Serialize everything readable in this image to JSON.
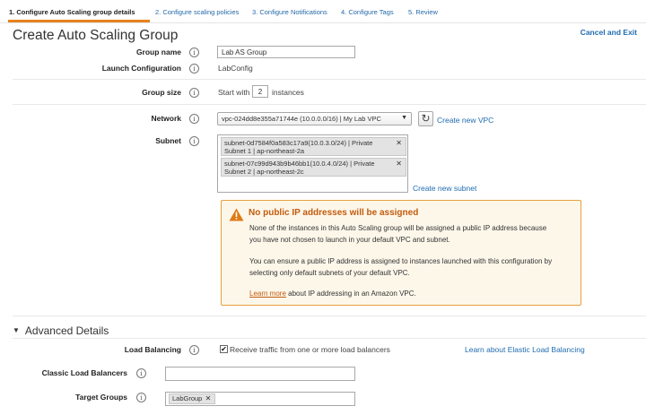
{
  "wizard_tabs": [
    {
      "label": "1. Configure Auto Scaling group details",
      "active": true
    },
    {
      "label": "2. Configure scaling policies",
      "active": false
    },
    {
      "label": "3. Configure Notifications",
      "active": false
    },
    {
      "label": "4. Configure Tags",
      "active": false
    },
    {
      "label": "5. Review",
      "active": false
    }
  ],
  "header": {
    "title": "Create Auto Scaling Group",
    "cancel_label": "Cancel and Exit"
  },
  "form": {
    "group_name": {
      "label": "Group name",
      "value": "Lab AS Group"
    },
    "launch_configuration": {
      "label": "Launch Configuration",
      "value": "LabConfig"
    },
    "group_size": {
      "label": "Group size",
      "prefix": "Start with",
      "value": "2",
      "suffix": "instances"
    },
    "network": {
      "label": "Network",
      "selected": "vpc-024dd8e355a71744e (10.0.0.0/16) | My Lab VPC",
      "create_link": "Create new VPC"
    },
    "subnet": {
      "label": "Subnet",
      "chips": [
        {
          "line1": "subnet-0d7584f0a583c17a9(10.0.3.0/24) | Private",
          "line2": "Subnet 1 | ap-northeast-2a"
        },
        {
          "line1": "subnet-07c99d943b9b46bb1(10.0.4.0/24) | Private",
          "line2": "Subnet 2 | ap-northeast-2c"
        }
      ],
      "create_link": "Create new subnet"
    }
  },
  "warning": {
    "title": "No public IP addresses will be assigned",
    "paragraph1_line1": "None of the instances in this Auto Scaling group will be assigned a public IP address because",
    "paragraph1_line2": "you have not chosen to launch in your default VPC and subnet.",
    "paragraph2_line1": "You can ensure a public IP address is assigned to instances launched with this configuration by",
    "paragraph2_line2": "selecting only default subnets of your default VPC.",
    "learn_more": "Learn more",
    "learn_more_suffix": " about IP addressing in an Amazon VPC.",
    "accent_color": "#c35b0d"
  },
  "advanced": {
    "title": "Advanced Details",
    "load_balancing": {
      "label": "Load Balancing",
      "checkbox_label": "Receive traffic from one or more load balancers",
      "checked": true,
      "learn_link": "Learn about Elastic Load Balancing"
    },
    "classic_lb": {
      "label": "Classic Load Balancers",
      "value": ""
    },
    "target_groups": {
      "label": "Target Groups",
      "chips": [
        "LabGroup"
      ]
    }
  },
  "icons": {
    "info_glyph": "i",
    "remove_glyph": "✕",
    "refresh_glyph": "↻",
    "caret_glyph": "▼",
    "check_glyph": "✔"
  },
  "colors": {
    "link": "#1f6bb0",
    "tab_underline": "#e7821f",
    "warning_border": "#e7a03c",
    "warning_bg": "#fdf7ea"
  }
}
